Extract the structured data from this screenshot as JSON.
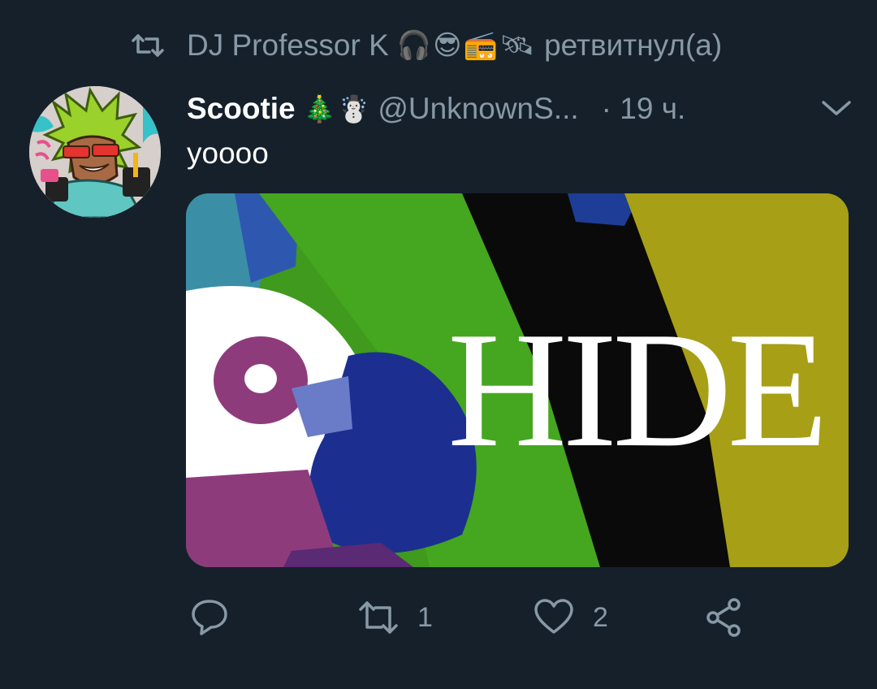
{
  "retweet_bar": {
    "retweeter_name": "DJ Professor K",
    "emojis": [
      "headphones-emoji",
      "sunglasses-emoji",
      "radio-emoji",
      "satellite-emoji"
    ],
    "label": "ретвитнул(а)"
  },
  "tweet": {
    "display_name": "Scootie",
    "name_emojis": [
      "christmas-tree-emoji",
      "snowman-emoji"
    ],
    "handle": "@UnknownS...",
    "time": "· 19 ч.",
    "text": "yoooo",
    "media_text": "HIDE"
  },
  "actions": {
    "reply_count": "",
    "retweet_count": "1",
    "like_count": "2"
  },
  "colors": {
    "background": "#15202b",
    "secondary_text": "#8899a6",
    "primary_text": "#ffffff"
  }
}
